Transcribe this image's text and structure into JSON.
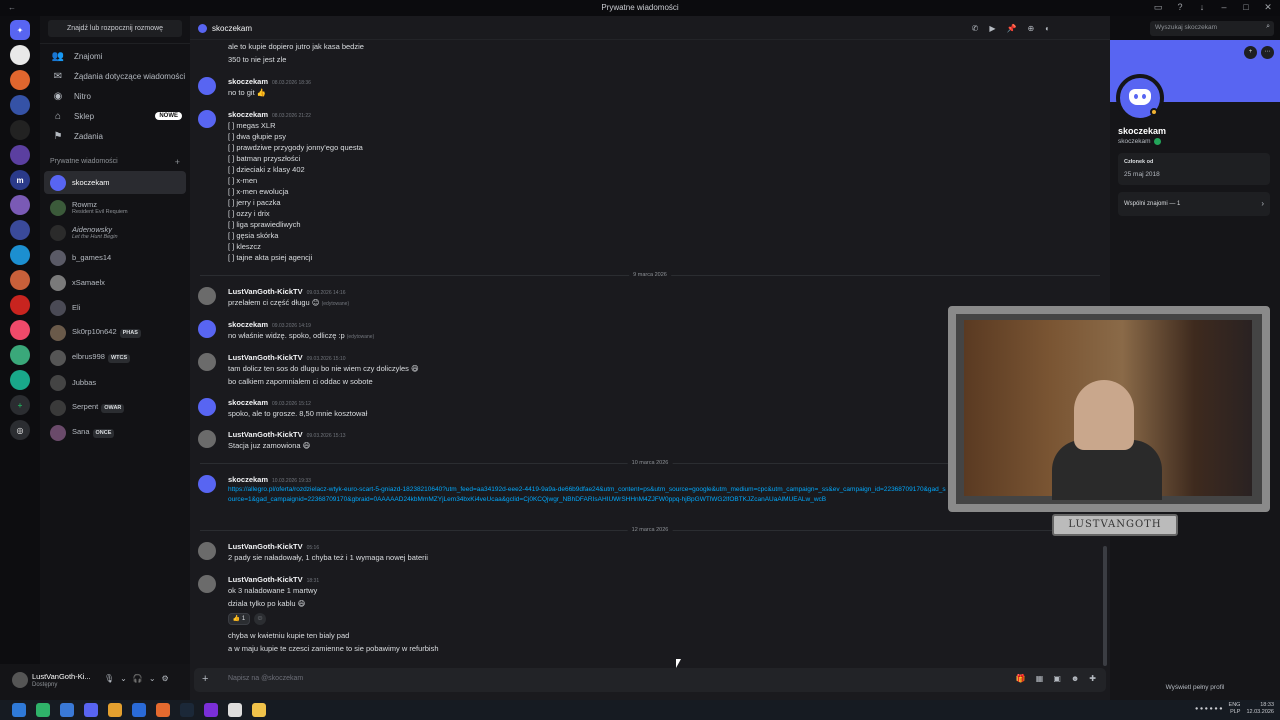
{
  "window": {
    "title": "Prywatne wiadomości"
  },
  "sidebar": {
    "search_button": "Znajdź lub rozpocznij rozmowę",
    "nav": [
      {
        "label": "Znajomi",
        "icon": "friends-icon"
      },
      {
        "label": "Żądania dotyczące wiadomości",
        "icon": "message-request-icon"
      },
      {
        "label": "Nitro",
        "icon": "nitro-icon"
      },
      {
        "label": "Sklep",
        "icon": "shop-icon",
        "badge": "NOWE"
      },
      {
        "label": "Zadania",
        "icon": "quests-icon"
      }
    ],
    "dm_header": "Prywatne wiadomości",
    "dms": [
      {
        "name": "skoczekam",
        "sub": "",
        "active": true
      },
      {
        "name": "Rowmz",
        "sub": "Resident Evil Requiem"
      },
      {
        "name": "Aidenowsky",
        "sub": "Let the Hunt Begin"
      },
      {
        "name": "b_games14",
        "sub": ""
      },
      {
        "name": "xSamaelx",
        "sub": ""
      },
      {
        "name": "Eli",
        "sub": ""
      },
      {
        "name": "Sk0rp10n642",
        "sub": "",
        "tag": "PHAS"
      },
      {
        "name": "elbrus998",
        "sub": "",
        "tag": "WTCS"
      },
      {
        "name": "Jubbas",
        "sub": ""
      },
      {
        "name": "Serpent",
        "sub": "",
        "tag": "OWAR"
      },
      {
        "name": "Sana",
        "sub": "",
        "tag": "ONCE"
      }
    ]
  },
  "userbar": {
    "name": "LustVanGoth-Ki...",
    "status": "Dostępny"
  },
  "chat": {
    "recipient": "skoczekam",
    "search_placeholder": "Wyszukaj skoczekam",
    "composer_placeholder": "Napisz na @skoczekam",
    "top_lines": [
      "ale to kupie dopiero jutro jak kasa bedzie",
      "350 to nie jest zle"
    ],
    "messages": [
      {
        "author": "skoczekam",
        "time": "08.03.2026 18:36",
        "lines": [
          "no to git 👍"
        ]
      },
      {
        "author": "skoczekam",
        "time": "08.03.2026 21:22",
        "lines": [
          "[ ] megas XLR",
          "[ ] dwa głupie psy",
          "[ ] prawdziwe przygody jonny'ego questa",
          "[ ] batman przyszłości",
          "[ ] dzieciaki z klasy 402",
          "[ ] x-men",
          "[ ] x-men ewolucja",
          "[ ] jerry i paczka",
          "[ ] ozzy i drix",
          "[ ] liga sprawiedliwych",
          "[ ] gęsia skórka",
          "[ ] kleszcz",
          "[ ] tajne akta psiej agencji"
        ]
      },
      {
        "author": "LustVanGoth-KickTV",
        "time": "09.03.2026 14:16",
        "lines": [
          "przelałem ci część długu 😊"
        ],
        "edited": "(edytowane)"
      },
      {
        "author": "skoczekam",
        "time": "09.03.2026 14:19",
        "lines": [
          "no właśnie widzę. spoko, odliczę :p"
        ],
        "edited": "(edytowane)"
      },
      {
        "author": "LustVanGoth-KickTV",
        "time": "09.03.2026 15:10",
        "lines": [
          "tam dolicz ten sos do dlugu bo nie wiem czy doliczyles 😄",
          "bo calkiem zapomnialem ci oddac w sobote"
        ]
      },
      {
        "author": "skoczekam",
        "time": "09.03.2026 15:12",
        "lines": [
          "spoko, ale to grosze. 8,50 mnie kosztował"
        ]
      },
      {
        "author": "LustVanGoth-KickTV",
        "time": "09.03.2026 15:13",
        "lines": [
          "Stacja juz zamowiona 😄"
        ]
      },
      {
        "author": "skoczekam",
        "time": "10.03.2026 19:33",
        "link": "https://allegro.pl/oferta/rozdzielacz-wtyk-euro-scart-5-gniazd-18238210640?utm_feed=aa34192d-eee2-4419-9a9a-de66b9dfae24&utm_content=ps&utm_source=google&utm_medium=cpc&utm_campaign=_ss&ev_campaign_id=22368709170&gad_source=1&gad_campaignid=22368709170&gbraid=0AAAAAD24kbMmMZYjLem34bxKi4veUcaa&gclid=Cj0KCQjwgr_NBhDFARIsAHIUWrSHHnM4ZJFW0ppq-hjBpGWTlWG2lfOBTKJZcanAUaAlMUEALw_wcB"
      },
      {
        "author": "LustVanGoth-KickTV",
        "time": "05:16",
        "lines": [
          "2 pady sie naładowały, 1 chyba też i 1 wymaga nowej baterii"
        ]
      },
      {
        "author": "LustVanGoth-KickTV",
        "time": "18:31",
        "lines": [
          "ok 3 naladowane 1 martwy",
          "dziala tylko po kablu 😄"
        ],
        "reaction": {
          "emoji": "👍",
          "count": "1"
        },
        "more_lines": [
          "chyba w kwietniu kupie ten bialy pad",
          "a w maju kupie te czesci zamienne to sie pobawimy w refurbish"
        ]
      }
    ],
    "dividers": [
      "9 marca 2026",
      "10 marca 2026",
      "12 marca 2026"
    ]
  },
  "profile": {
    "display_name": "skoczekam",
    "username": "skoczekam",
    "member_label": "Członek od",
    "member_since": "25 maj 2018",
    "mutual": "Wspólni znajomi — 1",
    "full_profile": "Wyświetl pełny profil"
  },
  "webcam": {
    "label": "LUSTVANGOTH"
  },
  "taskbar": {
    "lang1": "ENG",
    "lang2": "PLP",
    "time": "18:33",
    "date": "12.03.2026"
  }
}
